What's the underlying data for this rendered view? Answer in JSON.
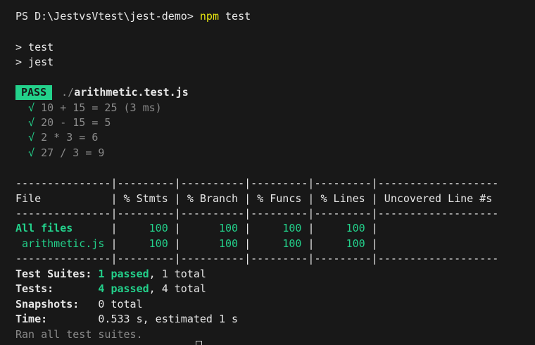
{
  "prompt": {
    "path": "PS D:\\JestvsVtest\\jest-demo>",
    "command": "npm",
    "args": "test"
  },
  "script_lines": [
    "> test",
    "> jest"
  ],
  "result": {
    "badge": "PASS",
    "file_dir": "./",
    "file_name": "arithmetic.test.js",
    "tests": [
      {
        "check": "√",
        "label": "10 + 15 = 25 (3 ms)"
      },
      {
        "check": "√",
        "label": "20 - 15 = 5"
      },
      {
        "check": "√",
        "label": "2 * 3 = 6"
      },
      {
        "check": "√",
        "label": "27 / 3 = 9"
      }
    ]
  },
  "coverage": {
    "separator": "---------------|---------|----------|---------|---------|-------------------",
    "header": "File           | % Stmts | % Branch | % Funcs | % Lines | Uncovered Line #s",
    "rows": [
      {
        "file": "All files     ",
        "stmts": "100",
        "branch": "100",
        "funcs": "100",
        "lines": "100",
        "uncovered": ""
      },
      {
        "file": " arithmetic.js",
        "stmts": "100",
        "branch": "100",
        "funcs": "100",
        "lines": "100",
        "uncovered": ""
      }
    ]
  },
  "summary": {
    "suites_label": "Test Suites:",
    "suites_passed": "1 passed",
    "suites_total": ", 1 total",
    "tests_label": "Tests:",
    "tests_passed": "4 passed",
    "tests_total": ", 4 total",
    "snapshots_label": "Snapshots:",
    "snapshots_value": "0 total",
    "time_label": "Time:",
    "time_value": "0.533 s, estimated 1 s",
    "footer": "Ran all test suites."
  }
}
